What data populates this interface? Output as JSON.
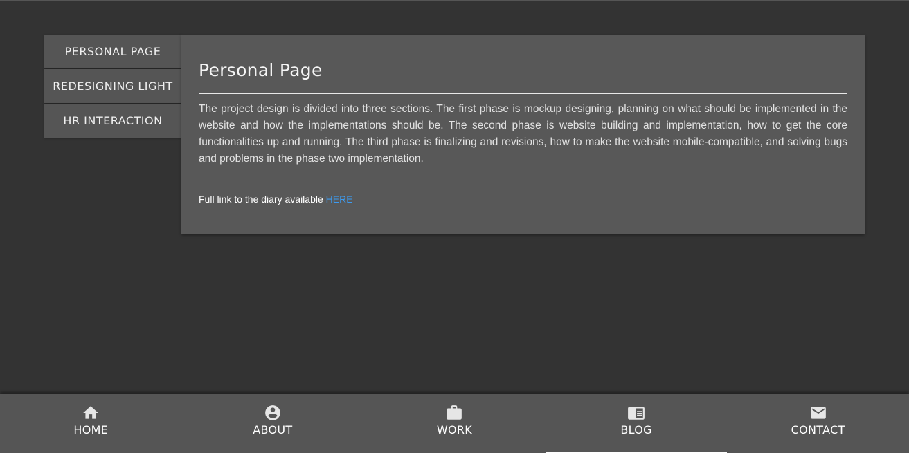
{
  "sidebar": {
    "tabs": [
      {
        "label": "PERSONAL PAGE"
      },
      {
        "label": "REDESIGNING LIGHT"
      },
      {
        "label": "HR INTERACTION"
      }
    ]
  },
  "article": {
    "title": "Personal Page",
    "description": "The project design is divided into three sections. The first phase is mockup designing, planning on what should be implemented in the website and how the implementations should be. The second phase is website building and implementation, how to get the core functionalities up and running. The third phase is finalizing and revisions, how to make the website mobile-compatible, and solving bugs and problems in the phase two implementation.",
    "link_prefix": "Full link to the diary available ",
    "link_text": "HERE"
  },
  "bottom_nav": {
    "items": [
      {
        "label": "HOME",
        "icon": "home-icon"
      },
      {
        "label": "ABOUT",
        "icon": "account-circle-icon"
      },
      {
        "label": "WORK",
        "icon": "briefcase-icon"
      },
      {
        "label": "BLOG",
        "icon": "chrome-reader-mode-icon"
      },
      {
        "label": "CONTACT",
        "icon": "mail-icon"
      }
    ],
    "active": "BLOG"
  },
  "colors": {
    "background": "#333333",
    "surface": "#585858",
    "link": "#3d9bf0"
  }
}
